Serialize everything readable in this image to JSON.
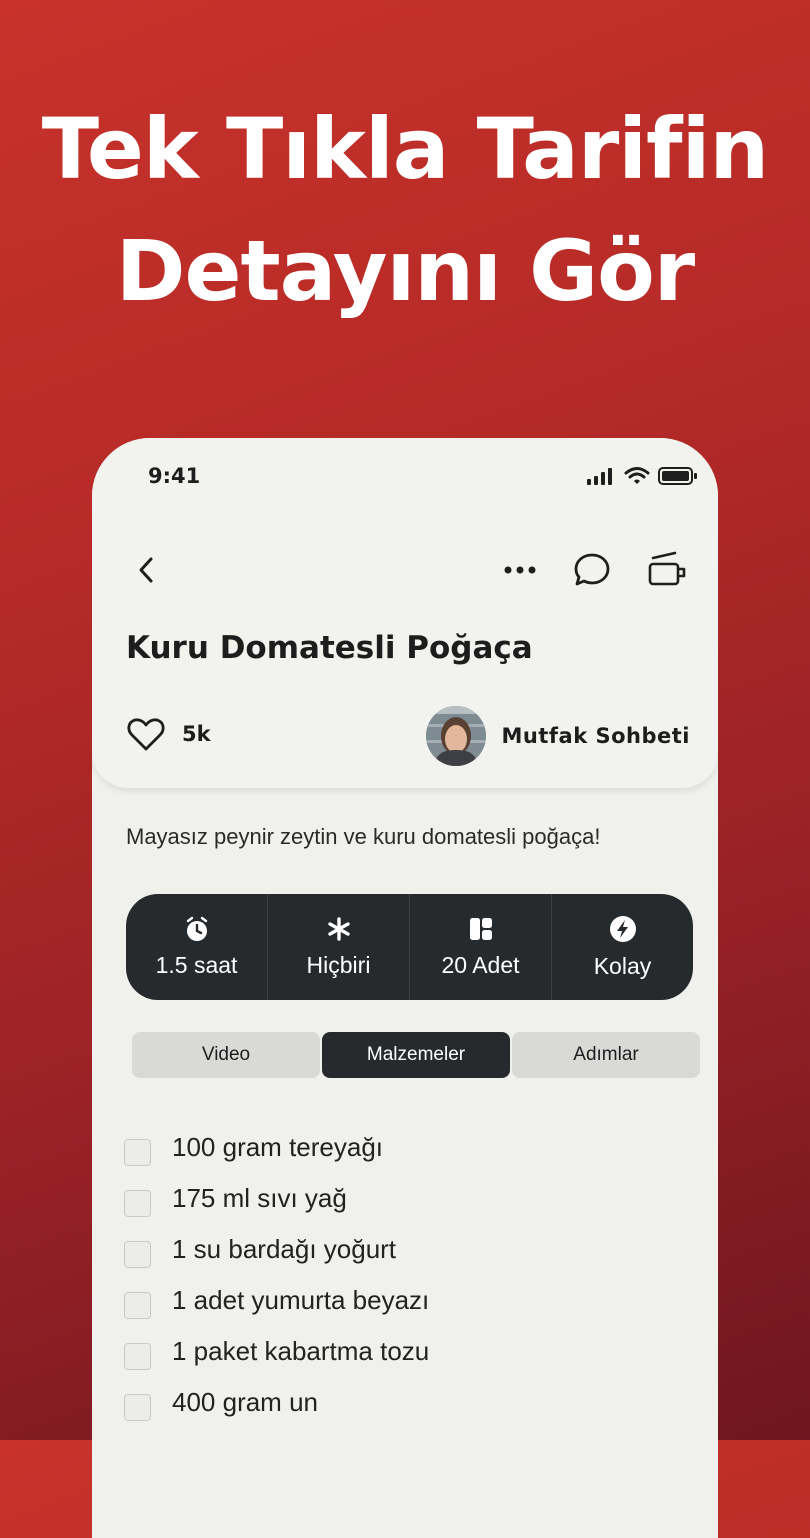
{
  "promo": {
    "line1": "Tek Tıkla Tarifin",
    "line2": "Detayını Gör"
  },
  "status_bar": {
    "time": "9:41"
  },
  "recipe": {
    "title": "Kuru Domatesli Poğaça",
    "likes": "5k",
    "author": "Mutfak Sohbeti",
    "description": "Mayasız peynir zeytin ve kuru domatesli poğaça!"
  },
  "stats": [
    {
      "icon": "timer-icon",
      "label": "1.5 saat"
    },
    {
      "icon": "asterisk-icon",
      "label": "Hiçbiri"
    },
    {
      "icon": "grid-icon",
      "label": "20 Adet"
    },
    {
      "icon": "bolt-icon",
      "label": "Kolay"
    }
  ],
  "tabs": [
    {
      "label": "Video",
      "active": false
    },
    {
      "label": "Malzemeler",
      "active": true
    },
    {
      "label": "Adımlar",
      "active": false
    }
  ],
  "ingredients": [
    "100 gram tereyağı",
    "175 ml sıvı yağ",
    "1 su bardağı yoğurt",
    "1 adet yumurta beyazı",
    "1 paket kabartma tozu",
    "400 gram un"
  ],
  "colors": {
    "background": "#b52a27",
    "card": "#f0f0ec",
    "dark": "#262a2d"
  }
}
